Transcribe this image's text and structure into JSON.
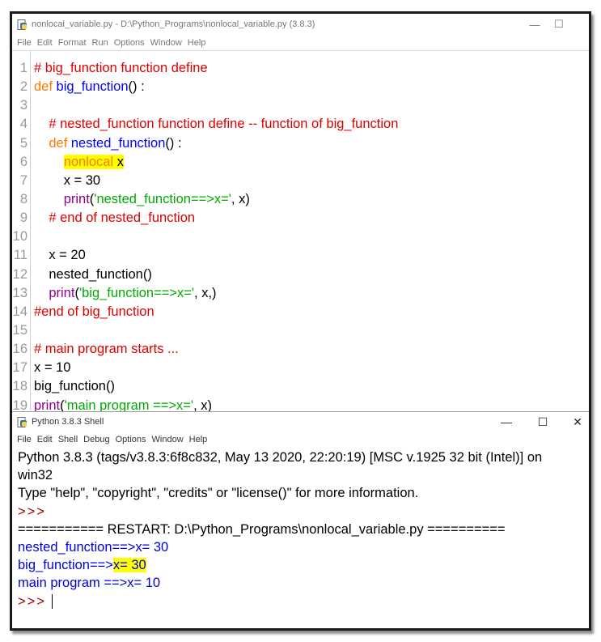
{
  "editor": {
    "title": "nonlocal_variable.py - D:\\Python_Programs\\nonlocal_variable.py (3.8.3)",
    "menu": [
      "File",
      "Edit",
      "Format",
      "Run",
      "Options",
      "Window",
      "Help"
    ],
    "lines": [
      {
        "n": "1",
        "indent": "",
        "segments": [
          {
            "t": "# big_function function define",
            "c": "cm"
          }
        ]
      },
      {
        "n": "2",
        "indent": "",
        "segments": [
          {
            "t": "def ",
            "c": "kw"
          },
          {
            "t": "big_function",
            "c": "def"
          },
          {
            "t": "() :",
            "c": ""
          }
        ]
      },
      {
        "n": "3",
        "indent": "",
        "segments": []
      },
      {
        "n": "4",
        "indent": "    ",
        "segments": [
          {
            "t": "# nested_function function define -- function of big_function",
            "c": "cm"
          }
        ]
      },
      {
        "n": "5",
        "indent": "    ",
        "segments": [
          {
            "t": "def ",
            "c": "kw"
          },
          {
            "t": "nested_function",
            "c": "def"
          },
          {
            "t": "() :",
            "c": ""
          }
        ]
      },
      {
        "n": "6",
        "indent": "        ",
        "segments": [
          {
            "t": "nonlocal",
            "c": "kw hl"
          },
          {
            "t": " x",
            "c": "hl"
          }
        ]
      },
      {
        "n": "7",
        "indent": "        ",
        "segments": [
          {
            "t": "x = 30",
            "c": ""
          }
        ]
      },
      {
        "n": "8",
        "indent": "        ",
        "segments": [
          {
            "t": "print",
            "c": "bi"
          },
          {
            "t": "(",
            "c": ""
          },
          {
            "t": "'nested_function==>x='",
            "c": "str"
          },
          {
            "t": ", x)",
            "c": ""
          }
        ]
      },
      {
        "n": "9",
        "indent": "    ",
        "segments": [
          {
            "t": "# end of nested_function",
            "c": "cm"
          }
        ]
      },
      {
        "n": "10",
        "indent": "",
        "segments": []
      },
      {
        "n": "11",
        "indent": "    ",
        "segments": [
          {
            "t": "x = 20",
            "c": ""
          }
        ]
      },
      {
        "n": "12",
        "indent": "    ",
        "segments": [
          {
            "t": "nested_function()",
            "c": ""
          }
        ]
      },
      {
        "n": "13",
        "indent": "    ",
        "segments": [
          {
            "t": "print",
            "c": "bi"
          },
          {
            "t": "(",
            "c": ""
          },
          {
            "t": "'big_function==>x='",
            "c": "str"
          },
          {
            "t": ", x,)",
            "c": ""
          }
        ]
      },
      {
        "n": "14",
        "indent": "",
        "segments": [
          {
            "t": "#end of big_function",
            "c": "cm"
          }
        ]
      },
      {
        "n": "15",
        "indent": "",
        "segments": []
      },
      {
        "n": "16",
        "indent": "",
        "segments": [
          {
            "t": "# main program starts ...",
            "c": "cm"
          }
        ]
      },
      {
        "n": "17",
        "indent": "",
        "segments": [
          {
            "t": "x = 10",
            "c": ""
          }
        ]
      },
      {
        "n": "18",
        "indent": "",
        "segments": [
          {
            "t": "big_function()",
            "c": ""
          }
        ]
      },
      {
        "n": "19",
        "indent": "",
        "segments": [
          {
            "t": "print",
            "c": "bi"
          },
          {
            "t": "(",
            "c": ""
          },
          {
            "t": "'main program ==>x='",
            "c": "str"
          },
          {
            "t": ", x)",
            "c": ""
          }
        ]
      }
    ]
  },
  "shell": {
    "title": "Python 3.8.3 Shell",
    "menu": [
      "File",
      "Edit",
      "Shell",
      "Debug",
      "Options",
      "Window",
      "Help"
    ],
    "lines": [
      {
        "segments": [
          {
            "t": "Python 3.8.3 (tags/v3.8.3:6f8c832, May 13 2020, 22:20:19) [MSC v.1925 32 bit (Intel)] on",
            "c": ""
          }
        ]
      },
      {
        "segments": [
          {
            "t": "win32",
            "c": ""
          }
        ]
      },
      {
        "segments": [
          {
            "t": "Type \"help\", \"copyright\", \"credits\" or \"license()\" for more information.",
            "c": ""
          }
        ]
      },
      {
        "segments": [
          {
            "t": ">>>",
            "c": "prompt"
          }
        ]
      },
      {
        "segments": [
          {
            "t": "=========== RESTART: D:\\Python_Programs\\nonlocal_variable.py ==========",
            "c": ""
          }
        ]
      },
      {
        "segments": [
          {
            "t": "nested_function==>x= 30",
            "c": "out"
          }
        ]
      },
      {
        "segments": [
          {
            "t": "big_function==>",
            "c": "out"
          },
          {
            "t": "x= 30",
            "c": "out hl"
          }
        ]
      },
      {
        "segments": [
          {
            "t": "main program ==>x= 10",
            "c": "out"
          }
        ]
      },
      {
        "segments": [
          {
            "t": ">>>",
            "c": "prompt"
          },
          {
            "t": " ",
            "c": ""
          }
        ]
      }
    ]
  },
  "window_controls": {
    "minimize": "—",
    "maximize": "☐",
    "close": "✕"
  },
  "colors": {
    "keyword": "#ff7700",
    "definition": "#0000ff",
    "comment": "#dd0000",
    "string": "#00aa00",
    "builtin": "#900090",
    "highlight": "#ffff00",
    "output": "#0000dd",
    "prompt": "#990000"
  }
}
